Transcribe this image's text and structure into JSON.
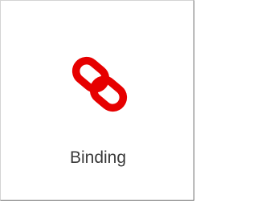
{
  "tile": {
    "label": "Binding",
    "icon": "link-icon",
    "accent_color": "#e60000"
  }
}
